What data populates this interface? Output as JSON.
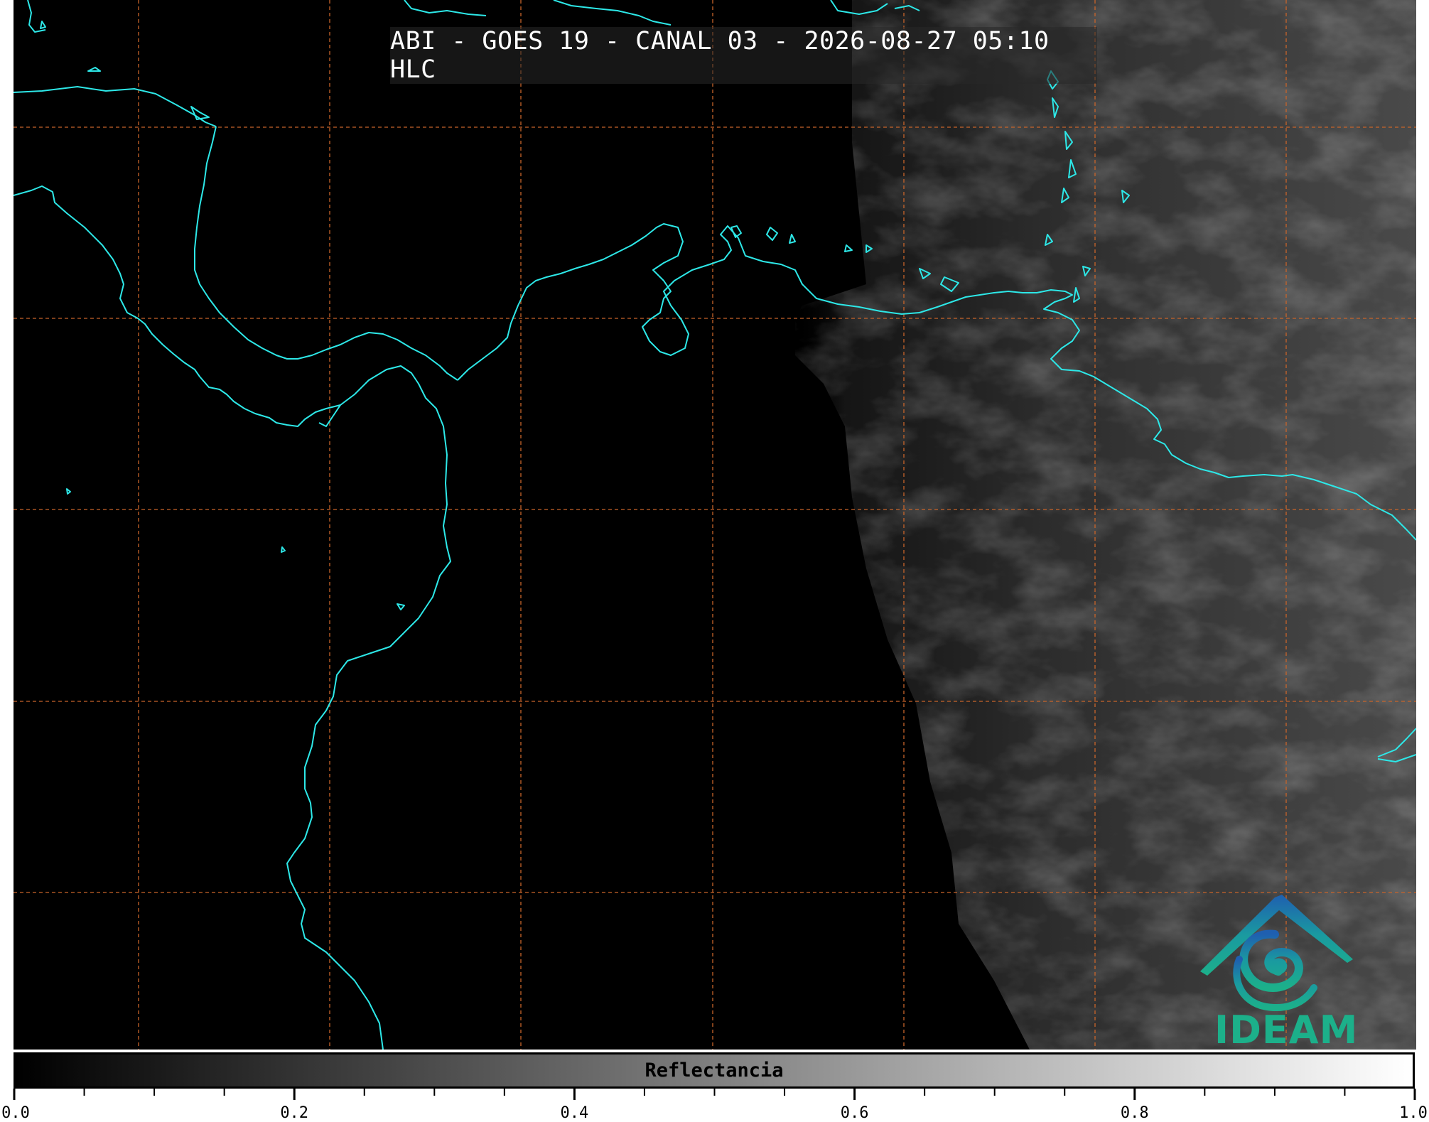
{
  "title": "ABI - GOES 19 - CANAL 03 - 2026-08-27 05:10 HLC",
  "colorbar": {
    "label": "Reflectancia",
    "min": 0.0,
    "max": 1.0,
    "tick_labels": [
      "0.0",
      "0.2",
      "0.4",
      "0.6",
      "0.8",
      "1.0"
    ],
    "colormap": [
      "#000000",
      "#ffffff"
    ]
  },
  "logo": {
    "text": "IDEAM"
  },
  "colors": {
    "coastline": "#2de8e8",
    "gridline": "#c8642a",
    "background": "#000000"
  },
  "map": {
    "gridlines": "dashed",
    "lit_region": "east"
  }
}
